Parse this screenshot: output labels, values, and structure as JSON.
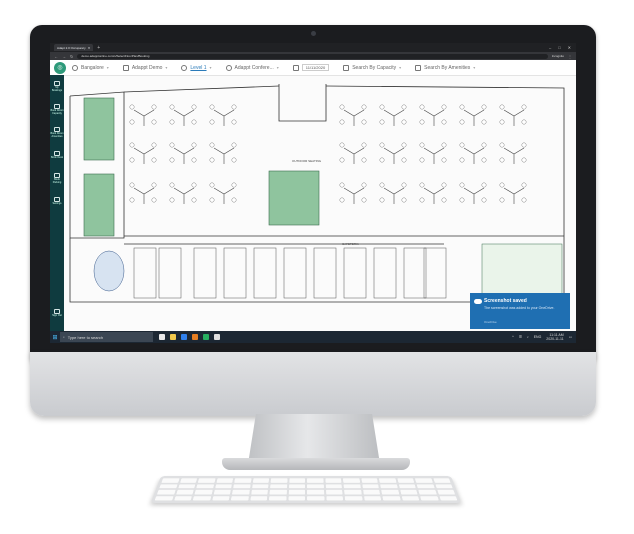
{
  "browser": {
    "tab_title": "Adapt 2.0 Occupancy",
    "new_tab": "+",
    "url": "demo.adapptonline.com/s/SelectFloorPlan/Booking",
    "profile": "Incognito",
    "window_controls": [
      "–",
      "□",
      "✕"
    ]
  },
  "app_bar": {
    "location": "Bangalore",
    "building": "Adappt Demo",
    "floor": "Level 1",
    "room": "Adappt Confere...",
    "date": "11/11/2020",
    "capacity": "Search By Capacity",
    "amenities": "Search By Amenities"
  },
  "sidebar": {
    "items": [
      {
        "label": "My Bookings",
        "icon": "calendar-icon"
      },
      {
        "label": "Book Room Capacity",
        "icon": "room-icon"
      },
      {
        "label": "Book Room Amenities",
        "icon": "monitor-icon"
      },
      {
        "label": "Book Desk",
        "icon": "desk-icon"
      },
      {
        "label": "Book Parking",
        "icon": "pin-icon"
      },
      {
        "label": "Settings",
        "icon": "gear-icon"
      }
    ],
    "signout": "Sign Out"
  },
  "floor_plan": {
    "labels": [
      "OUTDOOR SEATING",
      "CAFETERIA"
    ]
  },
  "taskbar": {
    "search_placeholder": "Type here to search",
    "time": "11:11 AM",
    "date": "2020-11-11",
    "lang": "ENG"
  },
  "toast": {
    "title": "Screenshot saved",
    "body": "The screenshot was added to your OneDrive.",
    "source": "OneDrive"
  },
  "colors": {
    "brand": "#2e9a7a",
    "sidebar": "#0f3b3f",
    "meeting_room": "#8fc49e",
    "toast": "#1f6fb2"
  }
}
